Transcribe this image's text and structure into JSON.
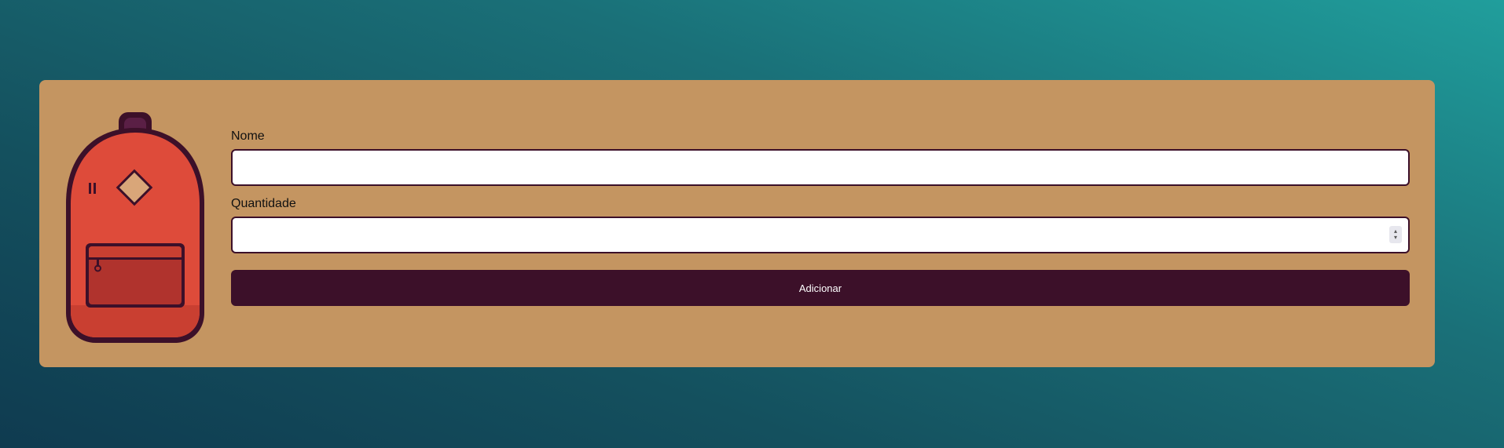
{
  "form": {
    "name_label": "Nome",
    "name_value": "",
    "name_placeholder": "",
    "quantity_label": "Quantidade",
    "quantity_value": "",
    "quantity_placeholder": "",
    "submit_label": "Adicionar"
  },
  "icons": {
    "illustration": "backpack-icon",
    "spinner": "number-spinner-icon"
  },
  "colors": {
    "card_background": "#c49561",
    "accent": "#3c1029",
    "backpack_body": "#de4b3a",
    "backpack_pocket": "#b0332d",
    "field_background": "#ffffff",
    "page_gradient_start": "#209e9c",
    "page_gradient_end": "#0f3b50"
  }
}
